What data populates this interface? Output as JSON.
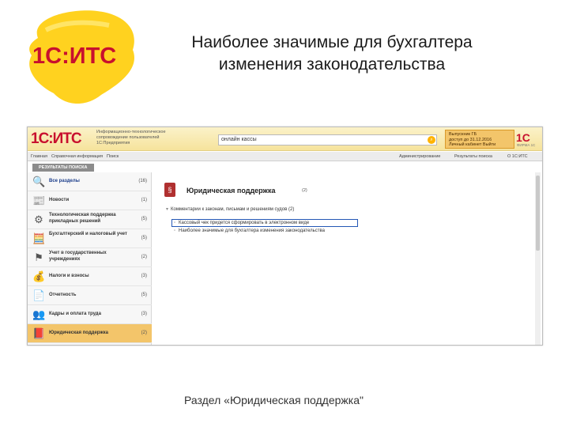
{
  "slide": {
    "title_line1": "Наиболее значимые для бухгалтера",
    "title_line2": "изменения законодательства",
    "caption": "Раздел «Юридическая поддержка\""
  },
  "big_logo": {
    "text": "1С:ИТС"
  },
  "app": {
    "logo": "1С:ИТС",
    "tagline": [
      "Информационно-технологическое",
      "сопровождение пользователей",
      "1С:Предприятия"
    ],
    "search": {
      "value": "онлайн кассы"
    },
    "account": {
      "lines": [
        "Выпускник ГБ",
        "доступ до 31.12.2016",
        "Личный кабинет   Выйти"
      ]
    },
    "brand_small": "1С",
    "brand_small_sub": "ФИРМА 1С",
    "menu_left": [
      "Главная",
      "Справочная информация",
      "Поиск"
    ],
    "menu_right": [
      "Администрирование",
      "Результаты поиска",
      "О 1С:ИТС"
    ],
    "results_tab": "РЕЗУЛЬТАТЫ ПОИСКА",
    "sidebar": [
      {
        "icon": "magnifier-icon",
        "glyph": "🔍",
        "label": "Все разделы",
        "count": "(16)"
      },
      {
        "icon": "news-icon",
        "glyph": "📰",
        "label": "Новости",
        "count": "(1)"
      },
      {
        "icon": "gear-icon",
        "glyph": "⚙",
        "label": "Технологическая поддержка прикладных решений",
        "count": "(5)"
      },
      {
        "icon": "calculator-icon",
        "glyph": "🧮",
        "label": "Бухгалтерский и налоговый учет",
        "count": "(5)"
      },
      {
        "icon": "flag-icon",
        "glyph": "⚑",
        "label": "Учет в государственных учреждениях",
        "count": "(2)"
      },
      {
        "icon": "coins-icon",
        "glyph": "💰",
        "label": "Налоги и взносы",
        "count": "(3)"
      },
      {
        "icon": "report-icon",
        "glyph": "📄",
        "label": "Отчетность",
        "count": "(5)"
      },
      {
        "icon": "people-icon",
        "glyph": "👥",
        "label": "Кадры и оплата труда",
        "count": "(3)"
      },
      {
        "icon": "law-book-icon",
        "glyph": "📕",
        "label": "Юридическая поддержка",
        "count": "(2)"
      }
    ],
    "content": {
      "section_title": "Юридическая поддержка",
      "section_count": "(2)",
      "group": "Комментарии к законам, письмам и решениям судов (2)",
      "items": [
        "Кассовый чек придется сформировать в электронном виде",
        "Наиболее значимые для бухгалтера изменения законодательства"
      ]
    }
  },
  "colors": {
    "brand_red": "#c8102e",
    "header_yellow": "#f6e39c",
    "active_orange": "#f3c56a",
    "highlight_blue": "#2457b5"
  }
}
